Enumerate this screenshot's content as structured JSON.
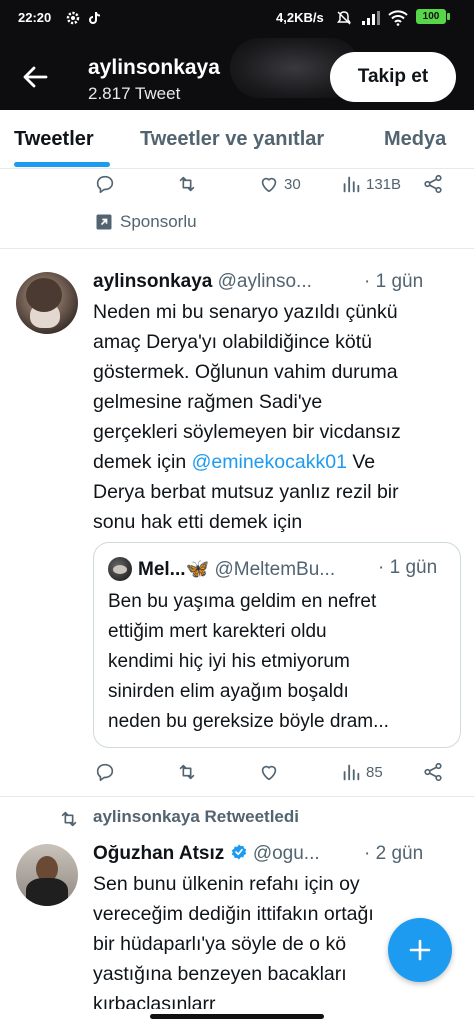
{
  "status_bar": {
    "time": "22:20",
    "net_speed": "4,2KB/s",
    "battery": "100"
  },
  "profile": {
    "name": "aylinsonkaya",
    "tweet_count": "2.817 Tweet",
    "follow_label": "Takip et"
  },
  "tabs": [
    {
      "label": "Tweetler",
      "active": true
    },
    {
      "label": "Tweetler ve yanıtlar",
      "active": false
    },
    {
      "label": "Medya",
      "active": false
    }
  ],
  "promo_tweet": {
    "likes": "30",
    "views": "131B",
    "promoted_label": "Sponsorlu"
  },
  "tweet1": {
    "display_name": "aylinsonkaya",
    "handle": "@aylinso...",
    "time": "· 1 gün",
    "text_part1": "Neden mi bu senaryo yazıldı çünkü\namaç Derya'yı olabildiğince kötü\ngöstermek. Oğlunun vahim duruma\ngelmesine rağmen Sadi'ye\ngerçekleri söylemeyen bir vicdansız\ndemek için ",
    "mention": "@eminekocakk01",
    "text_part2": " Ve\nDerya berbat mutsuz yanlız rezil bir\nsonu hak etti demek için",
    "views": "85",
    "quote": {
      "display_name": "Mel...🦋",
      "handle": "@MeltemBu...",
      "time": "· 1 gün",
      "text": "Ben bu yaşıma geldim en nefret\nettiğim mert karekteri oldu\nkendimi hiç iyi his etmiyorum\nsinirden elim ayağım boşaldı\nneden bu gereksize böyle dram..."
    }
  },
  "tweet2": {
    "retweet_label": "aylinsonkaya Retweetledi",
    "display_name": "Oğuzhan Atsız",
    "handle": "@ogu...",
    "time": "· 2 gün",
    "text": "Sen bunu ülkenin refahı için oy\nvereceğim dediğin ittifakın ortağı\nbir hüdaparlı'ya söyle de o kö\nyastığına benzeyen bacakları\nkırbaçlasınlarr"
  },
  "colors": {
    "accent": "#1d9bf0",
    "header_bg": "#0d0d10",
    "muted_text": "#536471",
    "verified": "#1d9bf0"
  },
  "icons": [
    "back-arrow-icon",
    "reply-icon",
    "retweet-icon",
    "like-icon",
    "views-icon",
    "share-icon",
    "promoted-icon",
    "verified-icon",
    "compose-plus-icon"
  ]
}
